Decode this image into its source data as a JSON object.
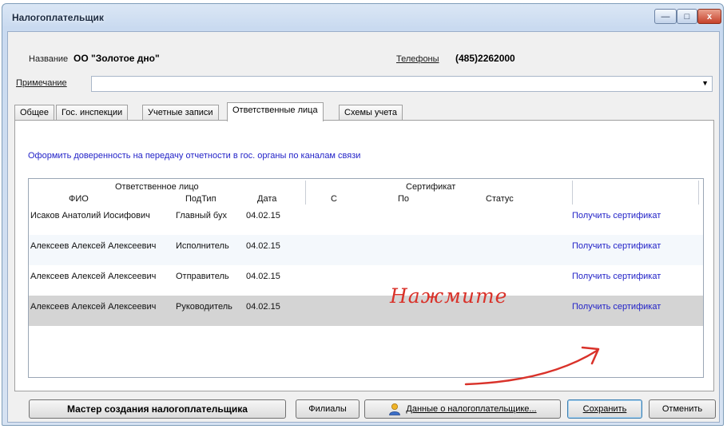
{
  "window": {
    "title": "Налогоплательщик",
    "close_glyph": "x",
    "min_glyph": "—",
    "max_glyph": "□"
  },
  "form": {
    "name_label": "Название",
    "name_value": "ОО \"Золотое дно\"",
    "phones_label": "Телефоны",
    "phones_value": "(485)2262000",
    "note_label": "Примечание",
    "note_value": ""
  },
  "tabs": [
    {
      "label": "Общее"
    },
    {
      "label": "Гос. инспекции"
    },
    {
      "label": "Учетные записи"
    },
    {
      "label": "Ответственные лица",
      "active": true
    },
    {
      "label": "Схемы учета"
    }
  ],
  "proxy_link": "Оформить доверенность на передачу отчетности в гос. органы по каналам связи",
  "grid": {
    "group_headers": {
      "responsible": "Ответственное лицо",
      "certificate": "Сертификат"
    },
    "columns": {
      "fio": "ФИО",
      "subtype": "ПодТип",
      "date": "Дата",
      "from": "С",
      "to": "По",
      "status": "Статус"
    },
    "rows": [
      {
        "fio": "Исаков Анатолий Иосифович",
        "subtype": "Главный бух",
        "date": "04.02.15",
        "action": "Получить сертификат"
      },
      {
        "fio": "Алексеев Алексей Алексеевич",
        "subtype": "Исполнитель",
        "date": "04.02.15",
        "action": "Получить сертификат"
      },
      {
        "fio": "Алексеев Алексей Алексеевич",
        "subtype": "Отправитель",
        "date": "04.02.15",
        "action": "Получить сертификат"
      },
      {
        "fio": "Алексеев Алексей Алексеевич",
        "subtype": "Руководитель",
        "date": "04.02.15",
        "action": "Получить сертификат",
        "selected": true
      }
    ]
  },
  "annotation": {
    "text": "Нажмите",
    "color": "#d9322a"
  },
  "buttons": {
    "wizard": "Мастер создания налогоплательщика",
    "branches": "Филиалы",
    "taxpayer_data": "Данные о налогоплательщике...",
    "save": "Сохранить",
    "cancel": "Отменить"
  },
  "icons": {
    "taxpayer_data": "person-icon"
  }
}
